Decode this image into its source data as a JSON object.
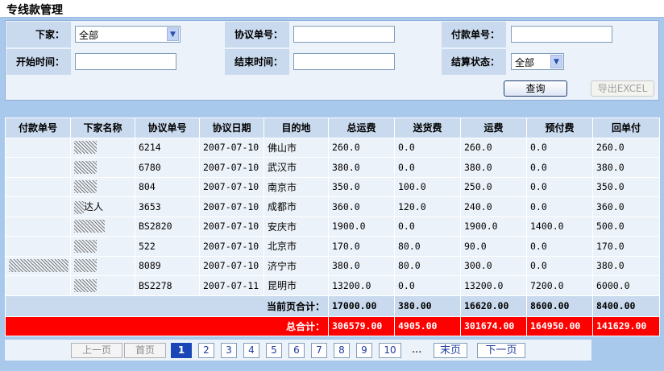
{
  "page": {
    "title": "专线款管理"
  },
  "filter": {
    "xiajia_label": "下家：",
    "xiajia_value": "全部",
    "xieyi_label": "协议单号：",
    "xieyi_value": "",
    "fukuan_label": "付款单号：",
    "fukuan_value": "",
    "start_label": "开始时间：",
    "start_value": "",
    "end_label": "结束时间：",
    "end_value": "",
    "status_label": "结算状态：",
    "status_value": "全部",
    "query_label": "查询",
    "export_label": "导出EXCEL"
  },
  "table": {
    "headers": [
      "付款单号",
      "下家名称",
      "协议单号",
      "协议日期",
      "目的地",
      "总运费",
      "送货费",
      "运费",
      "预付费",
      "回单付"
    ],
    "rows": [
      {
        "fukuan": "",
        "name": "",
        "xieyi": "6214",
        "date": "2007-07-10",
        "dest": "佛山市",
        "total": "260.0",
        "delivery": "0.0",
        "freight": "260.0",
        "prepaid": "0.0",
        "receipt": "260.0"
      },
      {
        "fukuan": "",
        "name": "",
        "xieyi": "6780",
        "date": "2007-07-10",
        "dest": "武汉市",
        "total": "380.0",
        "delivery": "0.0",
        "freight": "380.0",
        "prepaid": "0.0",
        "receipt": "380.0"
      },
      {
        "fukuan": "",
        "name": "",
        "xieyi": "804",
        "date": "2007-07-10",
        "dest": "南京市",
        "total": "350.0",
        "delivery": "100.0",
        "freight": "250.0",
        "prepaid": "0.0",
        "receipt": "350.0"
      },
      {
        "fukuan": "",
        "name": "达人",
        "xieyi": "3653",
        "date": "2007-07-10",
        "dest": "成都市",
        "total": "360.0",
        "delivery": "120.0",
        "freight": "240.0",
        "prepaid": "0.0",
        "receipt": "360.0"
      },
      {
        "fukuan": "",
        "name": "",
        "xieyi": "BS2820",
        "date": "2007-07-10",
        "dest": "安庆市",
        "total": "1900.0",
        "delivery": "0.0",
        "freight": "1900.0",
        "prepaid": "1400.0",
        "receipt": "500.0"
      },
      {
        "fukuan": "",
        "name": "",
        "xieyi": "522",
        "date": "2007-07-10",
        "dest": "北京市",
        "total": "170.0",
        "delivery": "80.0",
        "freight": "90.0",
        "prepaid": "0.0",
        "receipt": "170.0"
      },
      {
        "fukuan": "",
        "name": "",
        "xieyi": "8089",
        "date": "2007-07-10",
        "dest": "济宁市",
        "total": "380.0",
        "delivery": "80.0",
        "freight": "300.0",
        "prepaid": "0.0",
        "receipt": "380.0"
      },
      {
        "fukuan": "",
        "name": "",
        "xieyi": "BS2278",
        "date": "2007-07-11",
        "dest": "昆明市",
        "total": "13200.0",
        "delivery": "0.0",
        "freight": "13200.0",
        "prepaid": "7200.0",
        "receipt": "6000.0"
      }
    ],
    "page_sum": {
      "label": "当前页合计：",
      "total": "17000.00",
      "delivery": "380.00",
      "freight": "16620.00",
      "prepaid": "8600.00",
      "receipt": "8400.00"
    },
    "grand_sum": {
      "label": "总合计：",
      "total": "306579.00",
      "delivery": "4905.00",
      "freight": "301674.00",
      "prepaid": "164950.00",
      "receipt": "141629.00"
    }
  },
  "pager": {
    "prev": "上一页",
    "first": "首页",
    "pages": [
      "1",
      "2",
      "3",
      "4",
      "5",
      "6",
      "7",
      "8",
      "9",
      "10"
    ],
    "ellipsis": "...",
    "last": "末页",
    "next": "下一页"
  }
}
